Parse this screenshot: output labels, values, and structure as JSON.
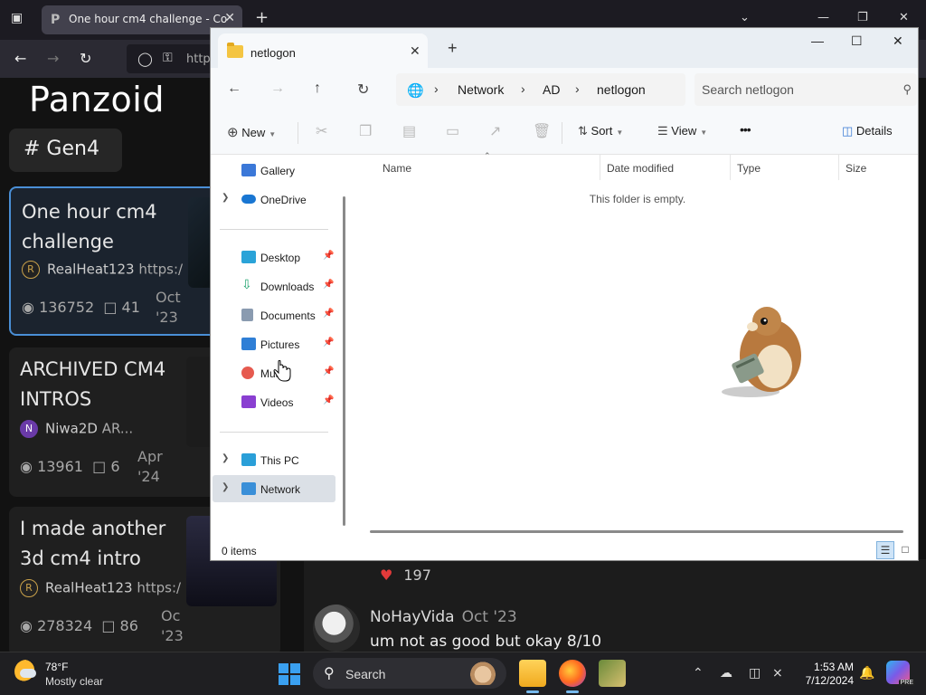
{
  "browser": {
    "tab_title": "One hour cm4 challenge - Co",
    "tab_favicon": "P",
    "url_partial": "http"
  },
  "panzoid": {
    "logo": "Panzoid",
    "tag": "# Gen4",
    "cards": [
      {
        "title": "One hour cm4 challenge",
        "author": "RealHeat123",
        "link": "https:/",
        "views": "136752",
        "comments": "41",
        "date": "Oct '23",
        "avatar": "R"
      },
      {
        "title": "ARCHIVED CM4 INTROS",
        "author": "Niwa2D",
        "link": "AR...",
        "views": "13961",
        "comments": "6",
        "date": "Apr '24",
        "avatar": "N"
      },
      {
        "title": "I made another 3d cm4 intro",
        "author": "RealHeat123",
        "link": "https:/",
        "views": "278324",
        "comments": "86",
        "date": "Oc '23",
        "avatar": "R"
      }
    ],
    "comment": {
      "likes": "197",
      "user": "NoHayVida",
      "date": "Oct '23",
      "text": "um not as good but okay 8/10"
    }
  },
  "explorer": {
    "tab_label": "netlogon",
    "breadcrumb": [
      "Network",
      "AD",
      "netlogon"
    ],
    "search_placeholder": "Search netlogon",
    "toolbar": {
      "new": "New",
      "sort": "Sort",
      "view": "View",
      "more": "•••",
      "details": "Details"
    },
    "sidebar": {
      "gallery": "Gallery",
      "onedrive": "OneDrive",
      "desktop": "Desktop",
      "downloads": "Downloads",
      "documents": "Documents",
      "pictures": "Pictures",
      "music": "Music",
      "videos": "Videos",
      "thispc": "This PC",
      "network": "Network"
    },
    "columns": [
      "Name",
      "Date modified",
      "Type",
      "Size"
    ],
    "empty_message": "This folder is empty.",
    "status": "0 items"
  },
  "taskbar": {
    "temperature": "78°F",
    "condition": "Mostly clear",
    "search_label": "Search",
    "time": "1:53 AM",
    "date": "7/12/2024",
    "copilot_badge": "PRE"
  },
  "colors": {
    "accent": "#3aa0f0",
    "selected_card_border": "#4a8fd6",
    "heart": "#e23a3a"
  }
}
